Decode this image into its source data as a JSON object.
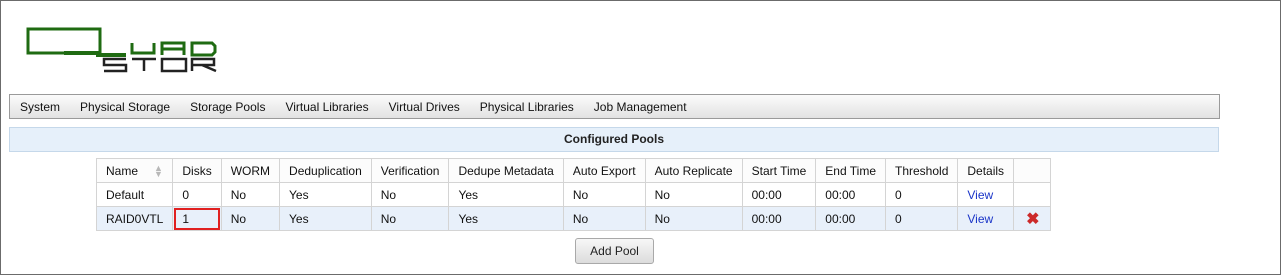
{
  "logo": {
    "text": "QUADSTOR",
    "color": "#1f6b12",
    "secondary_color": "#222222"
  },
  "nav": {
    "items": [
      "System",
      "Physical Storage",
      "Storage Pools",
      "Virtual Libraries",
      "Virtual Drives",
      "Physical Libraries",
      "Job Management"
    ]
  },
  "section": {
    "title": "Configured Pools"
  },
  "table": {
    "headers": [
      "Name",
      "Disks",
      "WORM",
      "Deduplication",
      "Verification",
      "Dedupe Metadata",
      "Auto Export",
      "Auto Replicate",
      "Start Time",
      "End Time",
      "Threshold",
      "Details",
      ""
    ],
    "rows": [
      {
        "name": "Default",
        "disks": "0",
        "worm": "No",
        "dedup": "Yes",
        "verification": "No",
        "dedupe_metadata": "Yes",
        "auto_export": "No",
        "auto_replicate": "No",
        "start_time": "00:00",
        "end_time": "00:00",
        "threshold": "0",
        "details": "View",
        "deletable": false
      },
      {
        "name": "RAID0VTL",
        "disks": "1",
        "worm": "No",
        "dedup": "Yes",
        "verification": "No",
        "dedupe_metadata": "Yes",
        "auto_export": "No",
        "auto_replicate": "No",
        "start_time": "00:00",
        "end_time": "00:00",
        "threshold": "0",
        "details": "View",
        "deletable": true,
        "highlighted_field": "disks"
      }
    ],
    "delete_icon": "delete-x-icon",
    "delete_color": "#cc2a2a",
    "highlight_color": "#e02020"
  },
  "actions": {
    "add_pool_label": "Add Pool"
  }
}
